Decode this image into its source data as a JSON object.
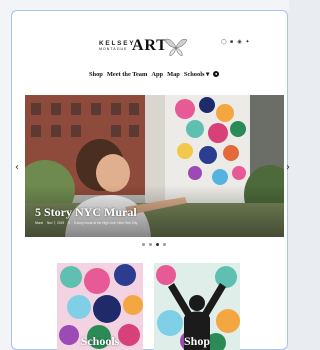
{
  "logo": {
    "name_small": "KELSEY",
    "name_sub": "MONTAGUE",
    "name_big": "ART"
  },
  "social": {
    "icons": [
      "instagram-icon",
      "facebook-icon",
      "pinterest-icon",
      "twitter-icon"
    ]
  },
  "nav": {
    "items": [
      "Shop",
      "Meet the Team",
      "App",
      "Map",
      "Schools ▾"
    ],
    "globe_icon": "globe-icon"
  },
  "hero": {
    "title": "5 Story NYC Mural",
    "meta": [
      "Mural",
      "Nov 7, 2019",
      "0",
      "5 story mural at the High Line, New York City"
    ]
  },
  "carousel": {
    "slide_count": 4,
    "active_index": 2
  },
  "cards": [
    {
      "label": "Schools"
    },
    {
      "label": "Shop"
    }
  ],
  "colors": {
    "frame_border": "#a8c4ef",
    "page_bg": "#e9ecf1"
  }
}
